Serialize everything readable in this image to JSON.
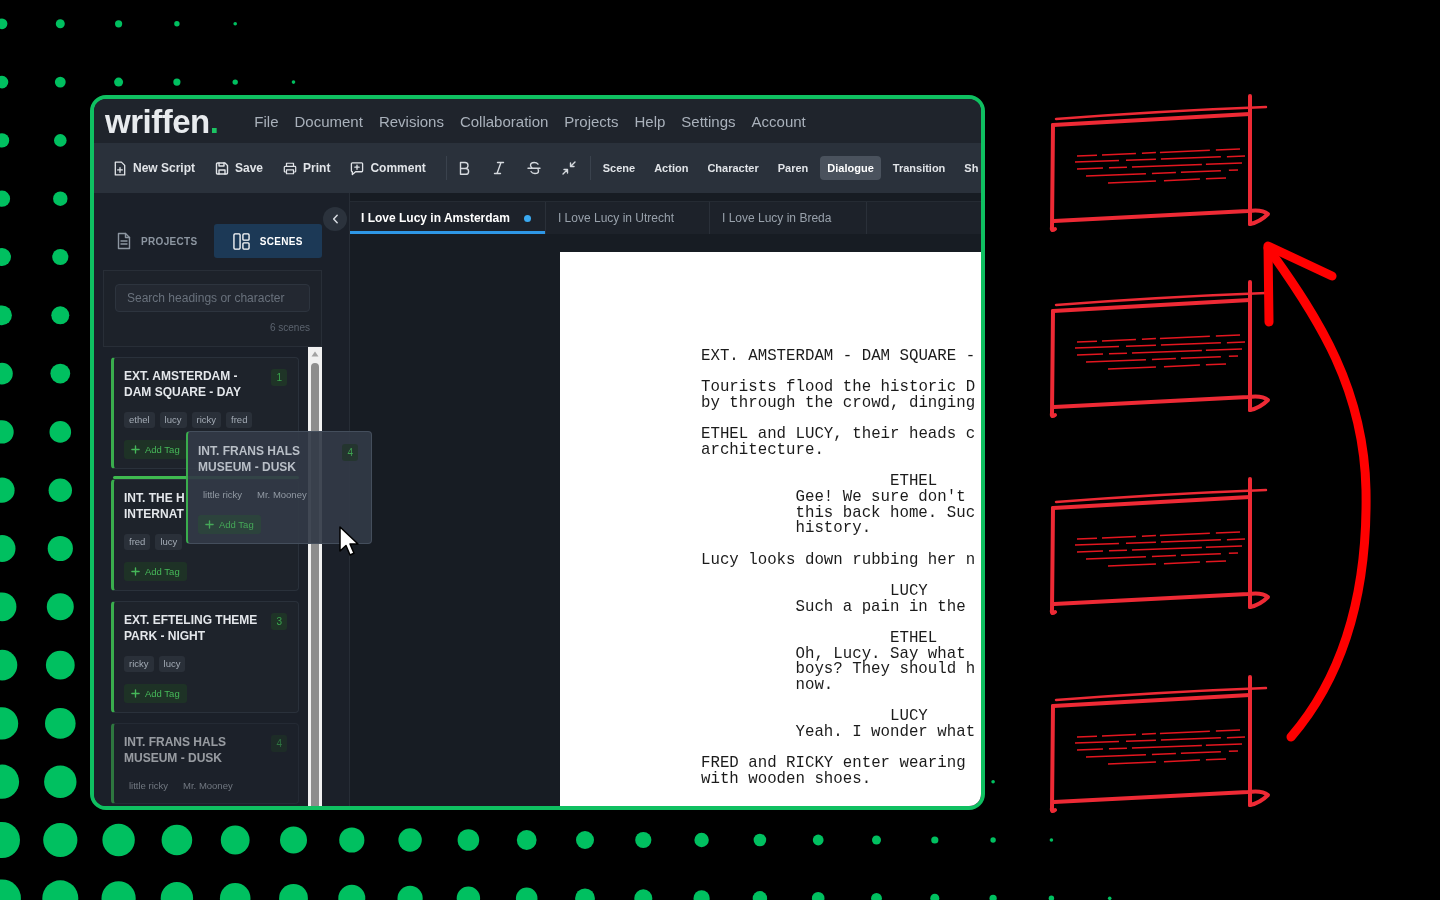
{
  "logo": {
    "name": "wriffen",
    "dot": "."
  },
  "menu": [
    "File",
    "Document",
    "Revisions",
    "Collaboration",
    "Projects",
    "Help",
    "Settings",
    "Account"
  ],
  "toolbar": {
    "actions": [
      {
        "kind": "new",
        "label": "New Script"
      },
      {
        "kind": "save",
        "label": "Save"
      },
      {
        "kind": "print",
        "label": "Print"
      },
      {
        "kind": "comment",
        "label": "Comment"
      }
    ],
    "elements": [
      {
        "label": "Scene",
        "selected": false
      },
      {
        "label": "Action",
        "selected": false
      },
      {
        "label": "Character",
        "selected": false
      },
      {
        "label": "Paren",
        "selected": false
      },
      {
        "label": "Dialogue",
        "selected": true
      },
      {
        "label": "Transition",
        "selected": false
      },
      {
        "label": "Sh",
        "selected": false
      }
    ]
  },
  "sidebar": {
    "tabs": [
      {
        "kind": "projects",
        "label": "PROJECTS",
        "selected": false
      },
      {
        "kind": "scenes",
        "label": "SCENES",
        "selected": true
      }
    ],
    "search": {
      "placeholder": "Search headings or character"
    },
    "count": "6 scenes",
    "scenes": [
      {
        "title": "EXT. AMSTERDAM - DAM SQUARE - DAY",
        "number": "1",
        "tags": [
          "ethel",
          "lucy",
          "ricky",
          "fred"
        ],
        "add_tag": "Add Tag",
        "drop_target": false,
        "dragging": false
      },
      {
        "title": "INT. THE H\nINTERNAT",
        "tags": [
          "fred",
          "lucy"
        ],
        "add_tag": "Add Tag",
        "drop_target": true,
        "dragging": false
      },
      {
        "title": "EXT. EFTELING THEME PARK - NIGHT",
        "number": "3",
        "tags": [
          "ricky",
          "lucy"
        ],
        "add_tag": "Add Tag",
        "drop_target": false,
        "dragging": false
      },
      {
        "title": "INT. FRANS HALS MUSEUM - DUSK",
        "number": "4",
        "tags": [
          "little ricky",
          "Mr. Mooney"
        ],
        "drop_target": false,
        "dragging": true
      }
    ],
    "drag_preview": {
      "title": "INT. FRANS HALS MUSEUM - DUSK",
      "number": "4",
      "tags": [
        "little ricky",
        "Mr. Mooney"
      ],
      "add_tag": "Add Tag"
    }
  },
  "editor": {
    "tabs": [
      {
        "label": "I Love Lucy in Amsterdam",
        "selected": true,
        "unsaved": true
      },
      {
        "label": "I Love Lucy in Utrecht",
        "selected": false,
        "unsaved": false
      },
      {
        "label": "I Love Lucy in Breda",
        "selected": false,
        "unsaved": false
      }
    ],
    "script": [
      {
        "kind": "scene",
        "lines": [
          "EXT. AMSTERDAM - DAM SQUARE -"
        ]
      },
      {
        "kind": "action",
        "lines": [
          "Tourists flood the historic D",
          "by through the crowd, dinging"
        ]
      },
      {
        "kind": "action",
        "lines": [
          "ETHEL and LUCY, their heads c",
          "architecture."
        ]
      },
      {
        "kind": "character",
        "lines": [
          "ETHEL"
        ]
      },
      {
        "kind": "dialogue",
        "lines": [
          "Gee! We sure don't",
          "this back home. Suc",
          "history."
        ]
      },
      {
        "kind": "action",
        "lines": [
          "Lucy looks down rubbing her n"
        ]
      },
      {
        "kind": "character",
        "lines": [
          "LUCY"
        ]
      },
      {
        "kind": "dialogue",
        "lines": [
          "Such a pain in the"
        ]
      },
      {
        "kind": "character",
        "lines": [
          "ETHEL"
        ]
      },
      {
        "kind": "dialogue",
        "lines": [
          "Oh, Lucy. Say what",
          "boys? They should h",
          "now."
        ]
      },
      {
        "kind": "character",
        "lines": [
          "LUCY"
        ]
      },
      {
        "kind": "dialogue",
        "lines": [
          "Yeah. I wonder what"
        ]
      },
      {
        "kind": "action",
        "lines": [
          "FRED and RICKY enter wearing",
          "with wooden shoes."
        ]
      }
    ]
  }
}
